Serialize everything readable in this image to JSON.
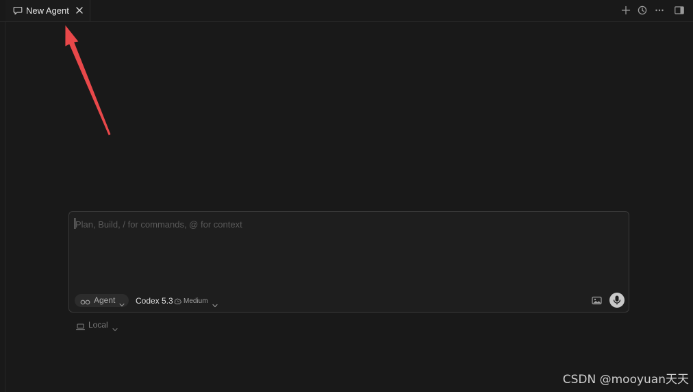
{
  "tab": {
    "title": "New Agent",
    "icon": "chat-bubble-icon"
  },
  "top_actions": [
    {
      "name": "new-agent-button",
      "icon": "plus-icon"
    },
    {
      "name": "history-button",
      "icon": "clock-icon"
    },
    {
      "name": "more-button",
      "icon": "ellipsis-icon"
    },
    {
      "name": "toggle-panel-button",
      "icon": "sidebar-icon"
    }
  ],
  "composer": {
    "placeholder": "Plan, Build, / for commands, @ for context",
    "mode_label": "Agent",
    "model_label": "Codex 5.3",
    "effort_label": "Medium"
  },
  "environment": {
    "label": "Local"
  },
  "watermark": "CSDN @mooyuan天天",
  "colors": {
    "background": "#191919",
    "annotation_arrow": "#e8484a",
    "composer_border": "#3a3a3a"
  }
}
